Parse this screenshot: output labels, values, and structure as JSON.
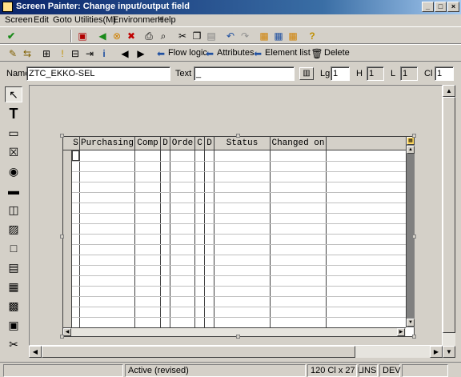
{
  "window": {
    "title": "Screen Painter: Change input/output field",
    "min": "_",
    "max": "□",
    "close": "×"
  },
  "menu": [
    "Screen",
    "Edit",
    "Goto",
    "Utilities(M)",
    "Environment",
    "Help"
  ],
  "toolbar3": {
    "flow_logic": "Flow logic",
    "attributes": "Attributes",
    "element_list": "Element list",
    "delete": "Delete"
  },
  "fields": {
    "name_label": "Name",
    "name_value": "ZTC_EKKO-SEL",
    "text_label": "Text",
    "text_value": "_",
    "lg_label": "Lg",
    "lg_value": "1",
    "h_label": "H",
    "h_value": "1",
    "l_label": "L",
    "l_value": "1",
    "cl_label": "Cl",
    "cl_value": "1"
  },
  "table": {
    "columns": [
      "S",
      "Purchasing",
      "Comp",
      "D",
      "Orde",
      "C",
      "D",
      "Status",
      "Changed on"
    ]
  },
  "statusbar": {
    "status": "Active (revised)",
    "size": "120 Cl x 27 L",
    "mode": "INS",
    "system": "DEV"
  },
  "colors": {
    "title_start": "#0a246a",
    "title_end": "#a6caf0",
    "background": "#d4d0c8"
  }
}
